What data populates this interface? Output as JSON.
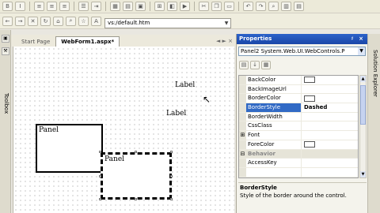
{
  "toolbar": {
    "address": "vs:/default.htm"
  },
  "toolbox": {
    "label": "Toolbox"
  },
  "tabs": [
    {
      "label": "Start Page",
      "active": false
    },
    {
      "label": "WebForm1.aspx*",
      "active": true
    }
  ],
  "tab_controls": "◄ ► ×",
  "designer": {
    "panel1_text": "Panel",
    "panel2_text": "Panel",
    "label1": "Label",
    "label2": "Label"
  },
  "properties": {
    "title": "Properties",
    "title_controls": "♯ ×",
    "object": "Panel2  System.Web.UI.WebControls.P",
    "rows": [
      {
        "gutter": "",
        "name": "BackColor",
        "value": "",
        "swatch": true
      },
      {
        "gutter": "",
        "name": "BackImageUrl",
        "value": ""
      },
      {
        "gutter": "",
        "name": "BorderColor",
        "value": "",
        "swatch": true
      },
      {
        "gutter": "",
        "name": "BorderStyle",
        "value": "Dashed",
        "selected": true
      },
      {
        "gutter": "",
        "name": "BorderWidth",
        "value": ""
      },
      {
        "gutter": "",
        "name": "CssClass",
        "value": ""
      },
      {
        "gutter": "⊞",
        "name": "Font",
        "value": ""
      },
      {
        "gutter": "",
        "name": "ForeColor",
        "value": "",
        "swatch": true
      },
      {
        "gutter": "⊟",
        "name": "Behavior",
        "value": "",
        "category": true
      },
      {
        "gutter": "",
        "name": "AccessKey",
        "value": ""
      },
      {
        "gutter": "",
        "name": "",
        "value": ""
      }
    ],
    "desc_title": "BorderStyle",
    "desc_text": "Style of the border around the control."
  },
  "solution": {
    "label": "Solution Explorer"
  },
  "colors": {
    "title_blue": "#1a47a8",
    "selection": "#316ac5"
  }
}
